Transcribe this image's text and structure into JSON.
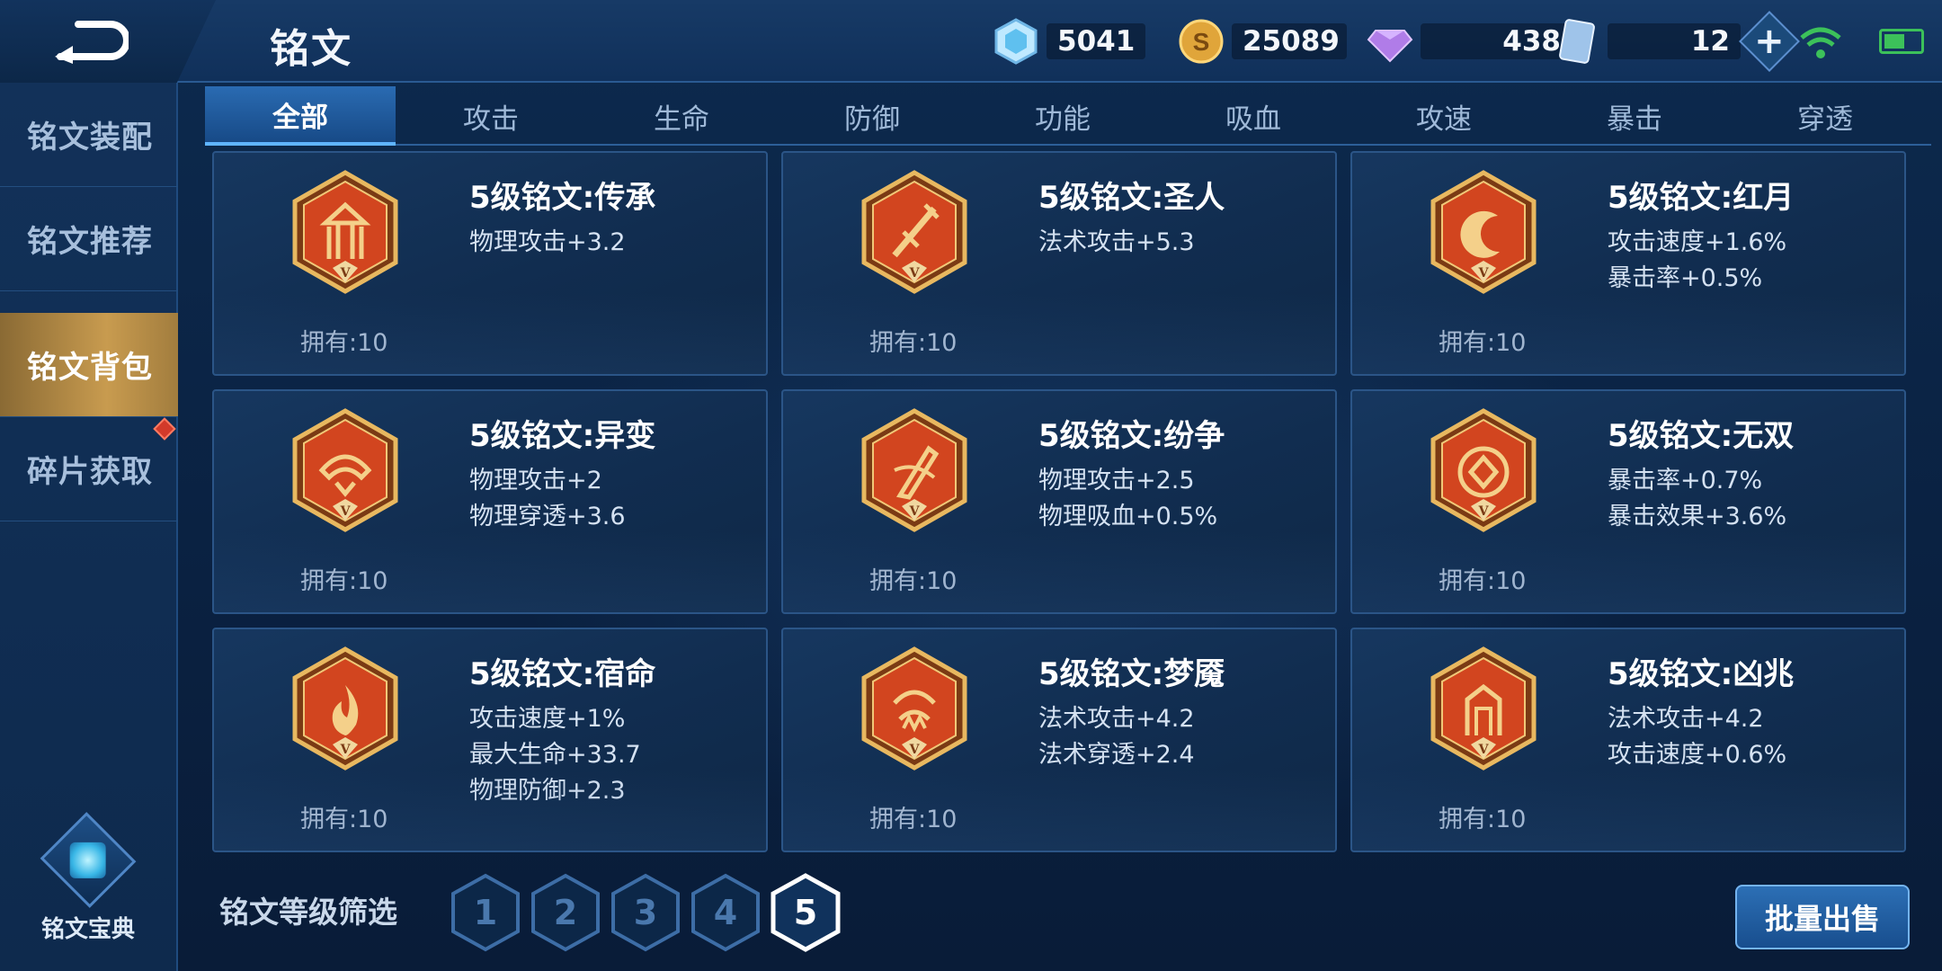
{
  "header": {
    "title": "铭文",
    "resources": {
      "crystal": "5041",
      "gold": "25089",
      "diamond": "438",
      "card": "12"
    }
  },
  "sidebar": {
    "items": [
      {
        "label": "铭文装配"
      },
      {
        "label": "铭文推荐"
      },
      {
        "label": "铭文背包"
      },
      {
        "label": "碎片获取"
      }
    ],
    "codex_label": "铭文宝典"
  },
  "tabs": [
    "全部",
    "攻击",
    "生命",
    "防御",
    "功能",
    "吸血",
    "攻速",
    "暴击",
    "穿透"
  ],
  "cards": [
    {
      "name": "5级铭文:传承",
      "stats": [
        "物理攻击+3.2"
      ],
      "owned": "拥有:10",
      "symbol": "pillars"
    },
    {
      "name": "5级铭文:圣人",
      "stats": [
        "法术攻击+5.3"
      ],
      "owned": "拥有:10",
      "symbol": "sword"
    },
    {
      "name": "5级铭文:红月",
      "stats": [
        "攻击速度+1.6%",
        "暴击率+0.5%"
      ],
      "owned": "拥有:10",
      "symbol": "moon"
    },
    {
      "name": "5级铭文:异变",
      "stats": [
        "物理攻击+2",
        "物理穿透+3.6"
      ],
      "owned": "拥有:10",
      "symbol": "mask"
    },
    {
      "name": "5级铭文:纷争",
      "stats": [
        "物理攻击+2.5",
        "物理吸血+0.5%"
      ],
      "owned": "拥有:10",
      "symbol": "blade"
    },
    {
      "name": "5级铭文:无双",
      "stats": [
        "暴击率+0.7%",
        "暴击效果+3.6%"
      ],
      "owned": "拥有:10",
      "symbol": "gem"
    },
    {
      "name": "5级铭文:宿命",
      "stats": [
        "攻击速度+1%",
        "最大生命+33.7",
        "物理防御+2.3"
      ],
      "owned": "拥有:10",
      "symbol": "flame"
    },
    {
      "name": "5级铭文:梦魇",
      "stats": [
        "法术攻击+4.2",
        "法术穿透+2.4"
      ],
      "owned": "拥有:10",
      "symbol": "claw"
    },
    {
      "name": "5级铭文:凶兆",
      "stats": [
        "法术攻击+4.2",
        "攻击速度+0.6%"
      ],
      "owned": "拥有:10",
      "symbol": "gate"
    }
  ],
  "emblem_level_mark": "V",
  "filter": {
    "label": "铭文等级筛选",
    "levels": [
      "1",
      "2",
      "3",
      "4",
      "5"
    ],
    "selected": "5"
  },
  "sell_button": "批量出售",
  "colors": {
    "accent_gold": "#c89b4f",
    "tab_active": "#2a6bb2",
    "emblem_red": "#d2451f"
  }
}
